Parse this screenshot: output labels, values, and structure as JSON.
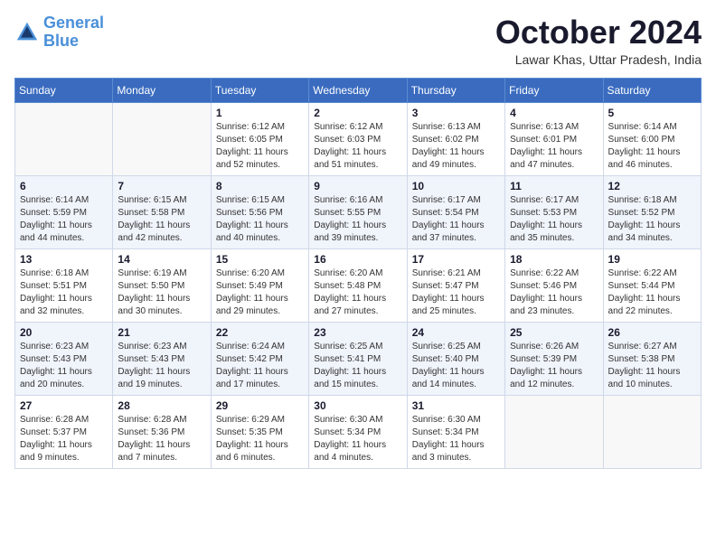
{
  "logo": {
    "line1": "General",
    "line2": "Blue"
  },
  "title": "October 2024",
  "location": "Lawar Khas, Uttar Pradesh, India",
  "headers": [
    "Sunday",
    "Monday",
    "Tuesday",
    "Wednesday",
    "Thursday",
    "Friday",
    "Saturday"
  ],
  "weeks": [
    [
      {
        "day": "",
        "info": ""
      },
      {
        "day": "",
        "info": ""
      },
      {
        "day": "1",
        "info": "Sunrise: 6:12 AM\nSunset: 6:05 PM\nDaylight: 11 hours and 52 minutes."
      },
      {
        "day": "2",
        "info": "Sunrise: 6:12 AM\nSunset: 6:03 PM\nDaylight: 11 hours and 51 minutes."
      },
      {
        "day": "3",
        "info": "Sunrise: 6:13 AM\nSunset: 6:02 PM\nDaylight: 11 hours and 49 minutes."
      },
      {
        "day": "4",
        "info": "Sunrise: 6:13 AM\nSunset: 6:01 PM\nDaylight: 11 hours and 47 minutes."
      },
      {
        "day": "5",
        "info": "Sunrise: 6:14 AM\nSunset: 6:00 PM\nDaylight: 11 hours and 46 minutes."
      }
    ],
    [
      {
        "day": "6",
        "info": "Sunrise: 6:14 AM\nSunset: 5:59 PM\nDaylight: 11 hours and 44 minutes."
      },
      {
        "day": "7",
        "info": "Sunrise: 6:15 AM\nSunset: 5:58 PM\nDaylight: 11 hours and 42 minutes."
      },
      {
        "day": "8",
        "info": "Sunrise: 6:15 AM\nSunset: 5:56 PM\nDaylight: 11 hours and 40 minutes."
      },
      {
        "day": "9",
        "info": "Sunrise: 6:16 AM\nSunset: 5:55 PM\nDaylight: 11 hours and 39 minutes."
      },
      {
        "day": "10",
        "info": "Sunrise: 6:17 AM\nSunset: 5:54 PM\nDaylight: 11 hours and 37 minutes."
      },
      {
        "day": "11",
        "info": "Sunrise: 6:17 AM\nSunset: 5:53 PM\nDaylight: 11 hours and 35 minutes."
      },
      {
        "day": "12",
        "info": "Sunrise: 6:18 AM\nSunset: 5:52 PM\nDaylight: 11 hours and 34 minutes."
      }
    ],
    [
      {
        "day": "13",
        "info": "Sunrise: 6:18 AM\nSunset: 5:51 PM\nDaylight: 11 hours and 32 minutes."
      },
      {
        "day": "14",
        "info": "Sunrise: 6:19 AM\nSunset: 5:50 PM\nDaylight: 11 hours and 30 minutes."
      },
      {
        "day": "15",
        "info": "Sunrise: 6:20 AM\nSunset: 5:49 PM\nDaylight: 11 hours and 29 minutes."
      },
      {
        "day": "16",
        "info": "Sunrise: 6:20 AM\nSunset: 5:48 PM\nDaylight: 11 hours and 27 minutes."
      },
      {
        "day": "17",
        "info": "Sunrise: 6:21 AM\nSunset: 5:47 PM\nDaylight: 11 hours and 25 minutes."
      },
      {
        "day": "18",
        "info": "Sunrise: 6:22 AM\nSunset: 5:46 PM\nDaylight: 11 hours and 23 minutes."
      },
      {
        "day": "19",
        "info": "Sunrise: 6:22 AM\nSunset: 5:44 PM\nDaylight: 11 hours and 22 minutes."
      }
    ],
    [
      {
        "day": "20",
        "info": "Sunrise: 6:23 AM\nSunset: 5:43 PM\nDaylight: 11 hours and 20 minutes."
      },
      {
        "day": "21",
        "info": "Sunrise: 6:23 AM\nSunset: 5:43 PM\nDaylight: 11 hours and 19 minutes."
      },
      {
        "day": "22",
        "info": "Sunrise: 6:24 AM\nSunset: 5:42 PM\nDaylight: 11 hours and 17 minutes."
      },
      {
        "day": "23",
        "info": "Sunrise: 6:25 AM\nSunset: 5:41 PM\nDaylight: 11 hours and 15 minutes."
      },
      {
        "day": "24",
        "info": "Sunrise: 6:25 AM\nSunset: 5:40 PM\nDaylight: 11 hours and 14 minutes."
      },
      {
        "day": "25",
        "info": "Sunrise: 6:26 AM\nSunset: 5:39 PM\nDaylight: 11 hours and 12 minutes."
      },
      {
        "day": "26",
        "info": "Sunrise: 6:27 AM\nSunset: 5:38 PM\nDaylight: 11 hours and 10 minutes."
      }
    ],
    [
      {
        "day": "27",
        "info": "Sunrise: 6:28 AM\nSunset: 5:37 PM\nDaylight: 11 hours and 9 minutes."
      },
      {
        "day": "28",
        "info": "Sunrise: 6:28 AM\nSunset: 5:36 PM\nDaylight: 11 hours and 7 minutes."
      },
      {
        "day": "29",
        "info": "Sunrise: 6:29 AM\nSunset: 5:35 PM\nDaylight: 11 hours and 6 minutes."
      },
      {
        "day": "30",
        "info": "Sunrise: 6:30 AM\nSunset: 5:34 PM\nDaylight: 11 hours and 4 minutes."
      },
      {
        "day": "31",
        "info": "Sunrise: 6:30 AM\nSunset: 5:34 PM\nDaylight: 11 hours and 3 minutes."
      },
      {
        "day": "",
        "info": ""
      },
      {
        "day": "",
        "info": ""
      }
    ]
  ]
}
